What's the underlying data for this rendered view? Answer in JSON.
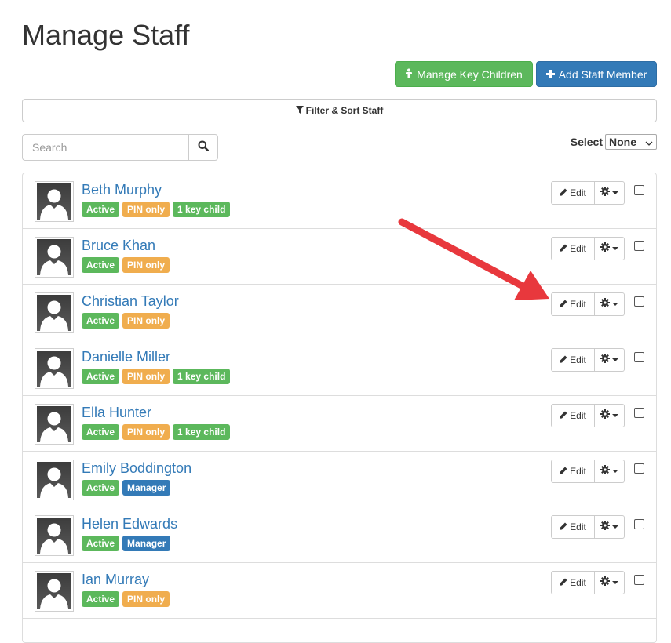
{
  "page": {
    "title": "Manage Staff"
  },
  "toolbar": {
    "manage_key_children_label": "Manage Key Children",
    "add_staff_label": "Add Staff Member"
  },
  "filter": {
    "label": "Filter & Sort Staff"
  },
  "search": {
    "placeholder": "Search",
    "value": ""
  },
  "select": {
    "label": "Select",
    "value": "None"
  },
  "row_actions": {
    "edit_label": "Edit"
  },
  "colors": {
    "success": "#5cb85c",
    "warning": "#f0ad4e",
    "primary": "#337ab7",
    "annotation_arrow": "#e8383d"
  },
  "icons": [
    "key-person-icon",
    "plus-icon",
    "filter-icon",
    "search-icon",
    "pencil-icon",
    "gear-icon",
    "chevron-down-icon"
  ],
  "staff": [
    {
      "name": "Beth Murphy",
      "badges": [
        {
          "text": "Active",
          "type": "active"
        },
        {
          "text": "PIN only",
          "type": "pin"
        },
        {
          "text": "1 key child",
          "type": "key"
        }
      ]
    },
    {
      "name": "Bruce Khan",
      "badges": [
        {
          "text": "Active",
          "type": "active"
        },
        {
          "text": "PIN only",
          "type": "pin"
        }
      ]
    },
    {
      "name": "Christian Taylor",
      "badges": [
        {
          "text": "Active",
          "type": "active"
        },
        {
          "text": "PIN only",
          "type": "pin"
        }
      ]
    },
    {
      "name": "Danielle Miller",
      "badges": [
        {
          "text": "Active",
          "type": "active"
        },
        {
          "text": "PIN only",
          "type": "pin"
        },
        {
          "text": "1 key child",
          "type": "key"
        }
      ]
    },
    {
      "name": "Ella Hunter",
      "badges": [
        {
          "text": "Active",
          "type": "active"
        },
        {
          "text": "PIN only",
          "type": "pin"
        },
        {
          "text": "1 key child",
          "type": "key"
        }
      ]
    },
    {
      "name": "Emily Boddington",
      "badges": [
        {
          "text": "Active",
          "type": "active"
        },
        {
          "text": "Manager",
          "type": "manager"
        }
      ]
    },
    {
      "name": "Helen Edwards",
      "badges": [
        {
          "text": "Active",
          "type": "active"
        },
        {
          "text": "Manager",
          "type": "manager"
        }
      ]
    },
    {
      "name": "Ian Murray",
      "badges": [
        {
          "text": "Active",
          "type": "active"
        },
        {
          "text": "PIN only",
          "type": "pin"
        }
      ]
    }
  ]
}
